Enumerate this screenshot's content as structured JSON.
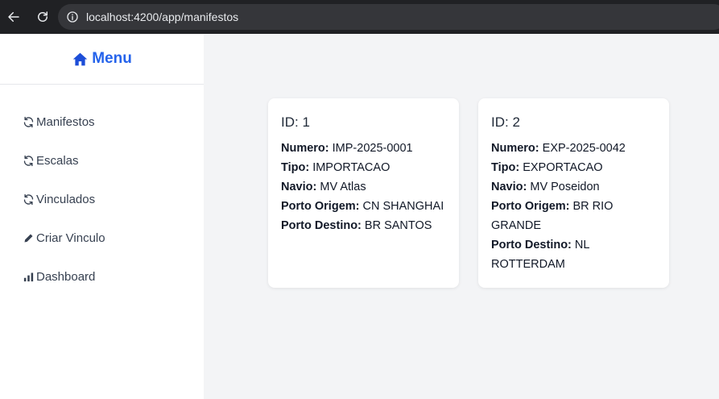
{
  "browser": {
    "url": "localhost:4200/app/manifestos",
    "back_icon": "arrow-left-icon",
    "reload_icon": "reload-icon",
    "info_icon": "info-circle-icon"
  },
  "sidebar": {
    "title": "Menu",
    "title_icon": "home-icon",
    "accent_color": "#2563eb",
    "items": [
      {
        "label": "Manifestos",
        "icon": "refresh-icon"
      },
      {
        "label": "Escalas",
        "icon": "refresh-icon"
      },
      {
        "label": "Vinculados",
        "icon": "refresh-icon"
      },
      {
        "label": "Criar Vinculo",
        "icon": "pencil-icon"
      },
      {
        "label": "Dashboard",
        "icon": "bar-chart-icon"
      }
    ]
  },
  "cards": [
    {
      "title": "ID: 1",
      "numero_label": "Numero:",
      "numero": "IMP-2025-0001",
      "tipo_label": "Tipo:",
      "tipo": "IMPORTACAO",
      "navio_label": "Navio:",
      "navio": "MV Atlas",
      "origem_label": "Porto Origem:",
      "origem": "CN SHANGHAI",
      "destino_label": "Porto Destino:",
      "destino": "BR SANTOS"
    },
    {
      "title": "ID: 2",
      "numero_label": "Numero:",
      "numero": "EXP-2025-0042",
      "tipo_label": "Tipo:",
      "tipo": "EXPORTACAO",
      "navio_label": "Navio:",
      "navio": "MV Poseidon",
      "origem_label": "Porto Origem:",
      "origem": "BR RIO GRANDE",
      "destino_label": "Porto Destino:",
      "destino": "NL ROTTERDAM"
    }
  ]
}
